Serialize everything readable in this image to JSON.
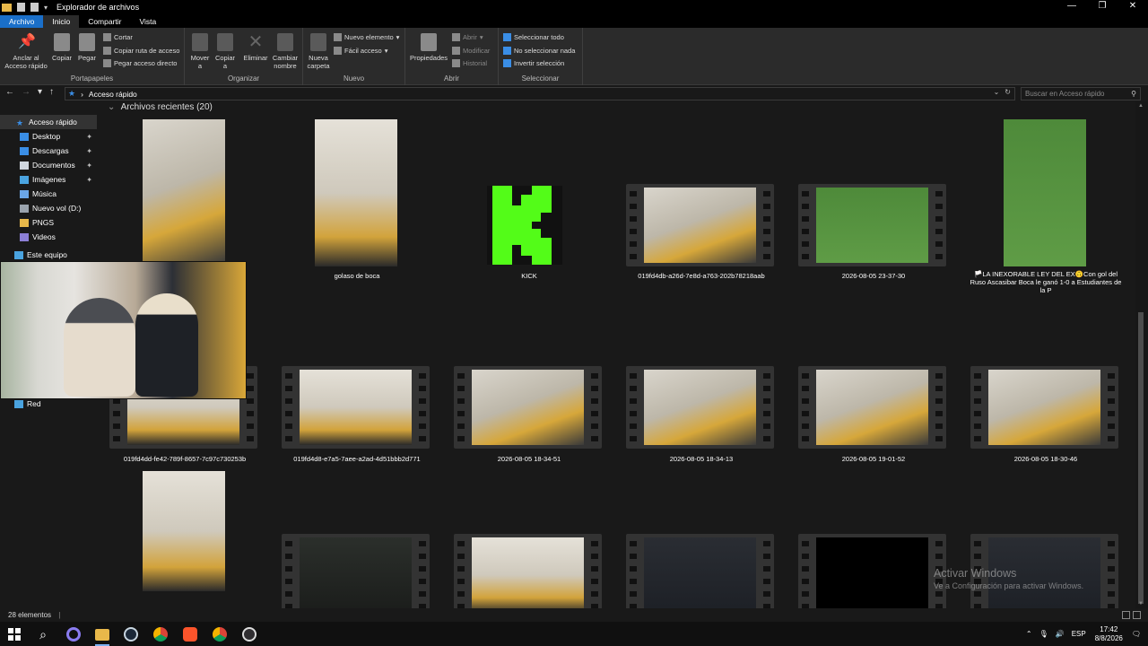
{
  "window": {
    "title": "Explorador de archivos",
    "controls": {
      "minimize": "—",
      "maximize": "❐",
      "close": "✕"
    }
  },
  "ribbon": {
    "tabs": [
      "Archivo",
      "Inicio",
      "Compartir",
      "Vista"
    ],
    "groups": {
      "portapapeles": {
        "label": "Portapapeles",
        "anclar": "Anclar al Acceso rápido",
        "anclar_l1": "Anclar al",
        "anclar_l2": "Acceso rápido",
        "copiar": "Copiar",
        "pegar": "Pegar",
        "cortar": "Cortar",
        "copiar_ruta": "Copiar ruta de acceso",
        "pegar_acceso": "Pegar acceso directo"
      },
      "organizar": {
        "label": "Organizar",
        "mover": "Mover",
        "mover_sub": "a",
        "copiar": "Copiar",
        "copiar_sub": "a",
        "eliminar": "Eliminar",
        "cambiar_l1": "Cambiar",
        "cambiar_l2": "nombre"
      },
      "nuevo": {
        "label": "Nuevo",
        "carpeta_l1": "Nueva",
        "carpeta_l2": "carpeta",
        "nuevo_elemento": "Nuevo elemento",
        "facil_acceso": "Fácil acceso"
      },
      "abrir": {
        "label": "Abrir",
        "propiedades": "Propiedades",
        "abrir": "Abrir",
        "modificar": "Modificar",
        "historial": "Historial"
      },
      "seleccionar": {
        "label": "Seleccionar",
        "todo": "Seleccionar todo",
        "nada": "No seleccionar nada",
        "invertir": "Invertir selección"
      }
    }
  },
  "address": {
    "path": "Acceso rápido",
    "search_placeholder": "Buscar en Acceso rápido"
  },
  "sidebar": {
    "items": [
      {
        "label": "Acceso rápido",
        "icon": "star-icon",
        "pinned": false
      },
      {
        "label": "Desktop",
        "icon": "desktop-icon",
        "pinned": true
      },
      {
        "label": "Descargas",
        "icon": "download-icon",
        "pinned": true
      },
      {
        "label": "Documentos",
        "icon": "documents-icon",
        "pinned": true
      },
      {
        "label": "Imágenes",
        "icon": "images-icon",
        "pinned": true
      },
      {
        "label": "Música",
        "icon": "music-icon",
        "pinned": false
      },
      {
        "label": "Nuevo vol (D:)",
        "icon": "drive-icon",
        "pinned": false
      },
      {
        "label": "PNGS",
        "icon": "folder-icon",
        "pinned": false
      },
      {
        "label": "Videos",
        "icon": "videos-icon",
        "pinned": false
      },
      {
        "label": "Este equipo",
        "icon": "computer-icon",
        "pinned": false
      },
      {
        "label": "Red",
        "icon": "network-icon",
        "pinned": false
      }
    ],
    "pin_glyph": "📌"
  },
  "content": {
    "section_title": "Archivos recientes (20)",
    "files": [
      {
        "name": "",
        "kind": "image"
      },
      {
        "name": "golaso de boca",
        "kind": "image"
      },
      {
        "name": "KICK",
        "kind": "image"
      },
      {
        "name": "019fd4db-a26d-7e8d-a763-202b78218aab",
        "kind": "video"
      },
      {
        "name": "2026-08-05 23-37-30",
        "kind": "video"
      },
      {
        "name": "🏳️LA INEXORABLE LEY DEL EX🙃Con gol del Ruso Ascasibar Boca le ganó 1-0 a Estudiantes de la P",
        "kind": "image"
      },
      {
        "name": "019fd4dd-fe42-789f-8657-7c97c730253b",
        "kind": "video"
      },
      {
        "name": "019fd4d8-e7a5-7aee-a2ad-4d51bbb2d771",
        "kind": "video"
      },
      {
        "name": "2026-08-05 18-34-51",
        "kind": "video"
      },
      {
        "name": "2026-08-05 18-34-13",
        "kind": "video"
      },
      {
        "name": "2026-08-05 19-01-52",
        "kind": "video"
      },
      {
        "name": "2026-08-05 18-30-46",
        "kind": "video"
      }
    ]
  },
  "status": {
    "count": "28 elementos"
  },
  "watermark": {
    "line1": "Activar Windows",
    "line2": "Ve a Configuración para activar Windows."
  },
  "taskbar": {
    "language": "ESP",
    "time": "17:42",
    "date": "8/8/2026",
    "apps": [
      "windows-start-icon",
      "search-icon",
      "cortana-icon",
      "file-explorer-icon",
      "steam-icon",
      "chrome-icon",
      "brave-icon",
      "chrome-profile-icon",
      "obs-icon"
    ]
  },
  "colors": {
    "accent": "#1a6fc9",
    "background": "#191919",
    "ribbon": "#2b2b2b",
    "kick_green": "#53fc18"
  }
}
